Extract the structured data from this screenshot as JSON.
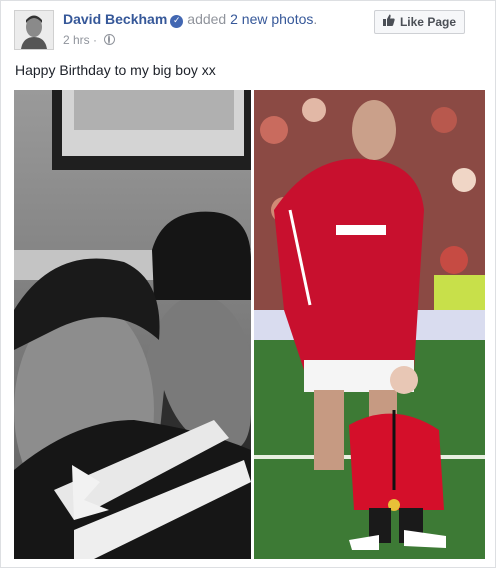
{
  "post": {
    "author": "David Beckham",
    "action_prefix": "added",
    "action_count": "2 new photos",
    "action_suffix": ".",
    "timestamp": "2 hrs",
    "privacy_icon": "globe-icon",
    "caption": "Happy Birthday to my big boy xx"
  },
  "like_button": {
    "label": "Like Page",
    "icon": "thumbs-up-icon"
  },
  "photos": [
    {
      "name": "photo-left",
      "kind": "black-and-white"
    },
    {
      "name": "photo-right",
      "kind": "color"
    }
  ],
  "colors": {
    "link": "#365899",
    "meta": "#90949c",
    "verified": "#4267b2",
    "jersey_red": "#c8102e"
  }
}
